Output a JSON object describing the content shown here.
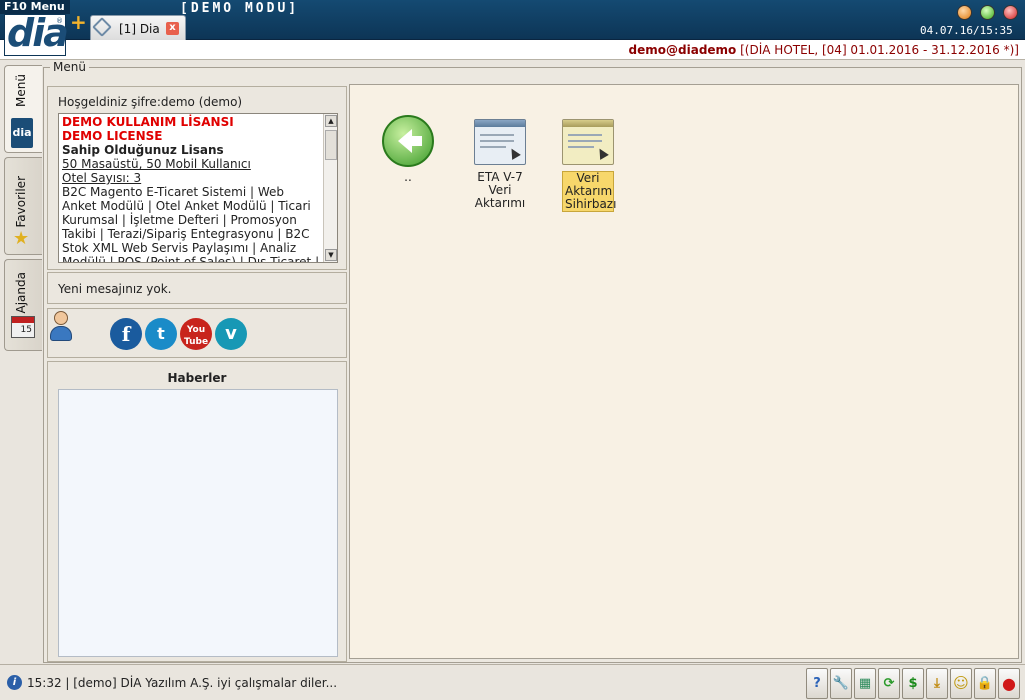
{
  "titlebar": {
    "f10_label": "F10 Menu",
    "logo_text": "dia",
    "logo_mark": "®",
    "demo_mode": "[DEMO MODU]",
    "clock": "04.07.16/15:35",
    "add_icon": "plus-icon"
  },
  "tabs": [
    {
      "label": "[1] Dia",
      "icon": "link-icon",
      "close_label": "x"
    }
  ],
  "userbar": {
    "user": "demo@diademo",
    "context": " [(DİA HOTEL, [04] 01.01.2016 - 31.12.2016 *)]"
  },
  "sidetabs": [
    {
      "label": "Menü",
      "icon": "dia-icon",
      "icon_text": "dia"
    },
    {
      "label": "Favoriler",
      "icon": "star-icon",
      "icon_text": "★"
    },
    {
      "label": "Ajanda",
      "icon": "calendar-icon",
      "icon_text": "15"
    }
  ],
  "menu": {
    "legend": "Menü",
    "welcome": "Hoşgeldiniz şifre:demo (demo)",
    "license": {
      "line1": "DEMO KULLANIM LİSANSI",
      "line2": "DEMO LICENSE",
      "owned_title": "Sahip Olduğunuz Lisans",
      "seats": "50 Masaüstü, 50 Mobil Kullanıcı",
      "hotel_count": "Otel Sayısı: 3",
      "modules": "B2C Magento E-Ticaret Sistemi | Web Anket Modülü | Otel Anket Modülü | Ticari Kurumsal | İşletme Defteri | Promosyon Takibi | Terazi/Sipariş Entegrasyonu | B2C Stok XML Web Servis Paylaşımı | Analiz Modülü | POS (Point of Sales) | Dış Ticaret | Kalite"
    },
    "message": "Yeni mesajınız yok.",
    "social": [
      {
        "name": "facebook",
        "glyph": "f"
      },
      {
        "name": "twitter",
        "glyph": "t"
      },
      {
        "name": "youtube",
        "glyph": "You Tube"
      },
      {
        "name": "vimeo",
        "glyph": "v"
      }
    ],
    "news_title": "Haberler"
  },
  "content": {
    "items": [
      {
        "label": "..",
        "icon": "back-arrow-icon"
      },
      {
        "label": "ETA V-7 Veri Aktarımı",
        "icon": "window-icon"
      },
      {
        "label": "Veri Aktarım Sihirbazı",
        "icon": "window-icon",
        "selected": true
      }
    ]
  },
  "status": {
    "info_icon": "i",
    "text": "15:32 | [demo] DİA Yazılım A.Ş. iyi çalışmalar diler..."
  },
  "tray": [
    {
      "name": "help",
      "glyph": "?",
      "color": "#2b62b8"
    },
    {
      "name": "tools",
      "glyph": "🔧",
      "color": "#555555"
    },
    {
      "name": "calculator",
      "glyph": "▦",
      "color": "#2a8a5a"
    },
    {
      "name": "sync",
      "glyph": "⟳",
      "color": "#2a9a2a"
    },
    {
      "name": "currency",
      "glyph": "$",
      "color": "#1a8a1a"
    },
    {
      "name": "download",
      "glyph": "⤓",
      "color": "#c08a10"
    },
    {
      "name": "smiley",
      "glyph": "☺",
      "color": "#c09a10"
    },
    {
      "name": "lock",
      "glyph": "🔒",
      "color": "#2b62b8"
    },
    {
      "name": "stop",
      "glyph": "●",
      "color": "#d01818"
    }
  ]
}
